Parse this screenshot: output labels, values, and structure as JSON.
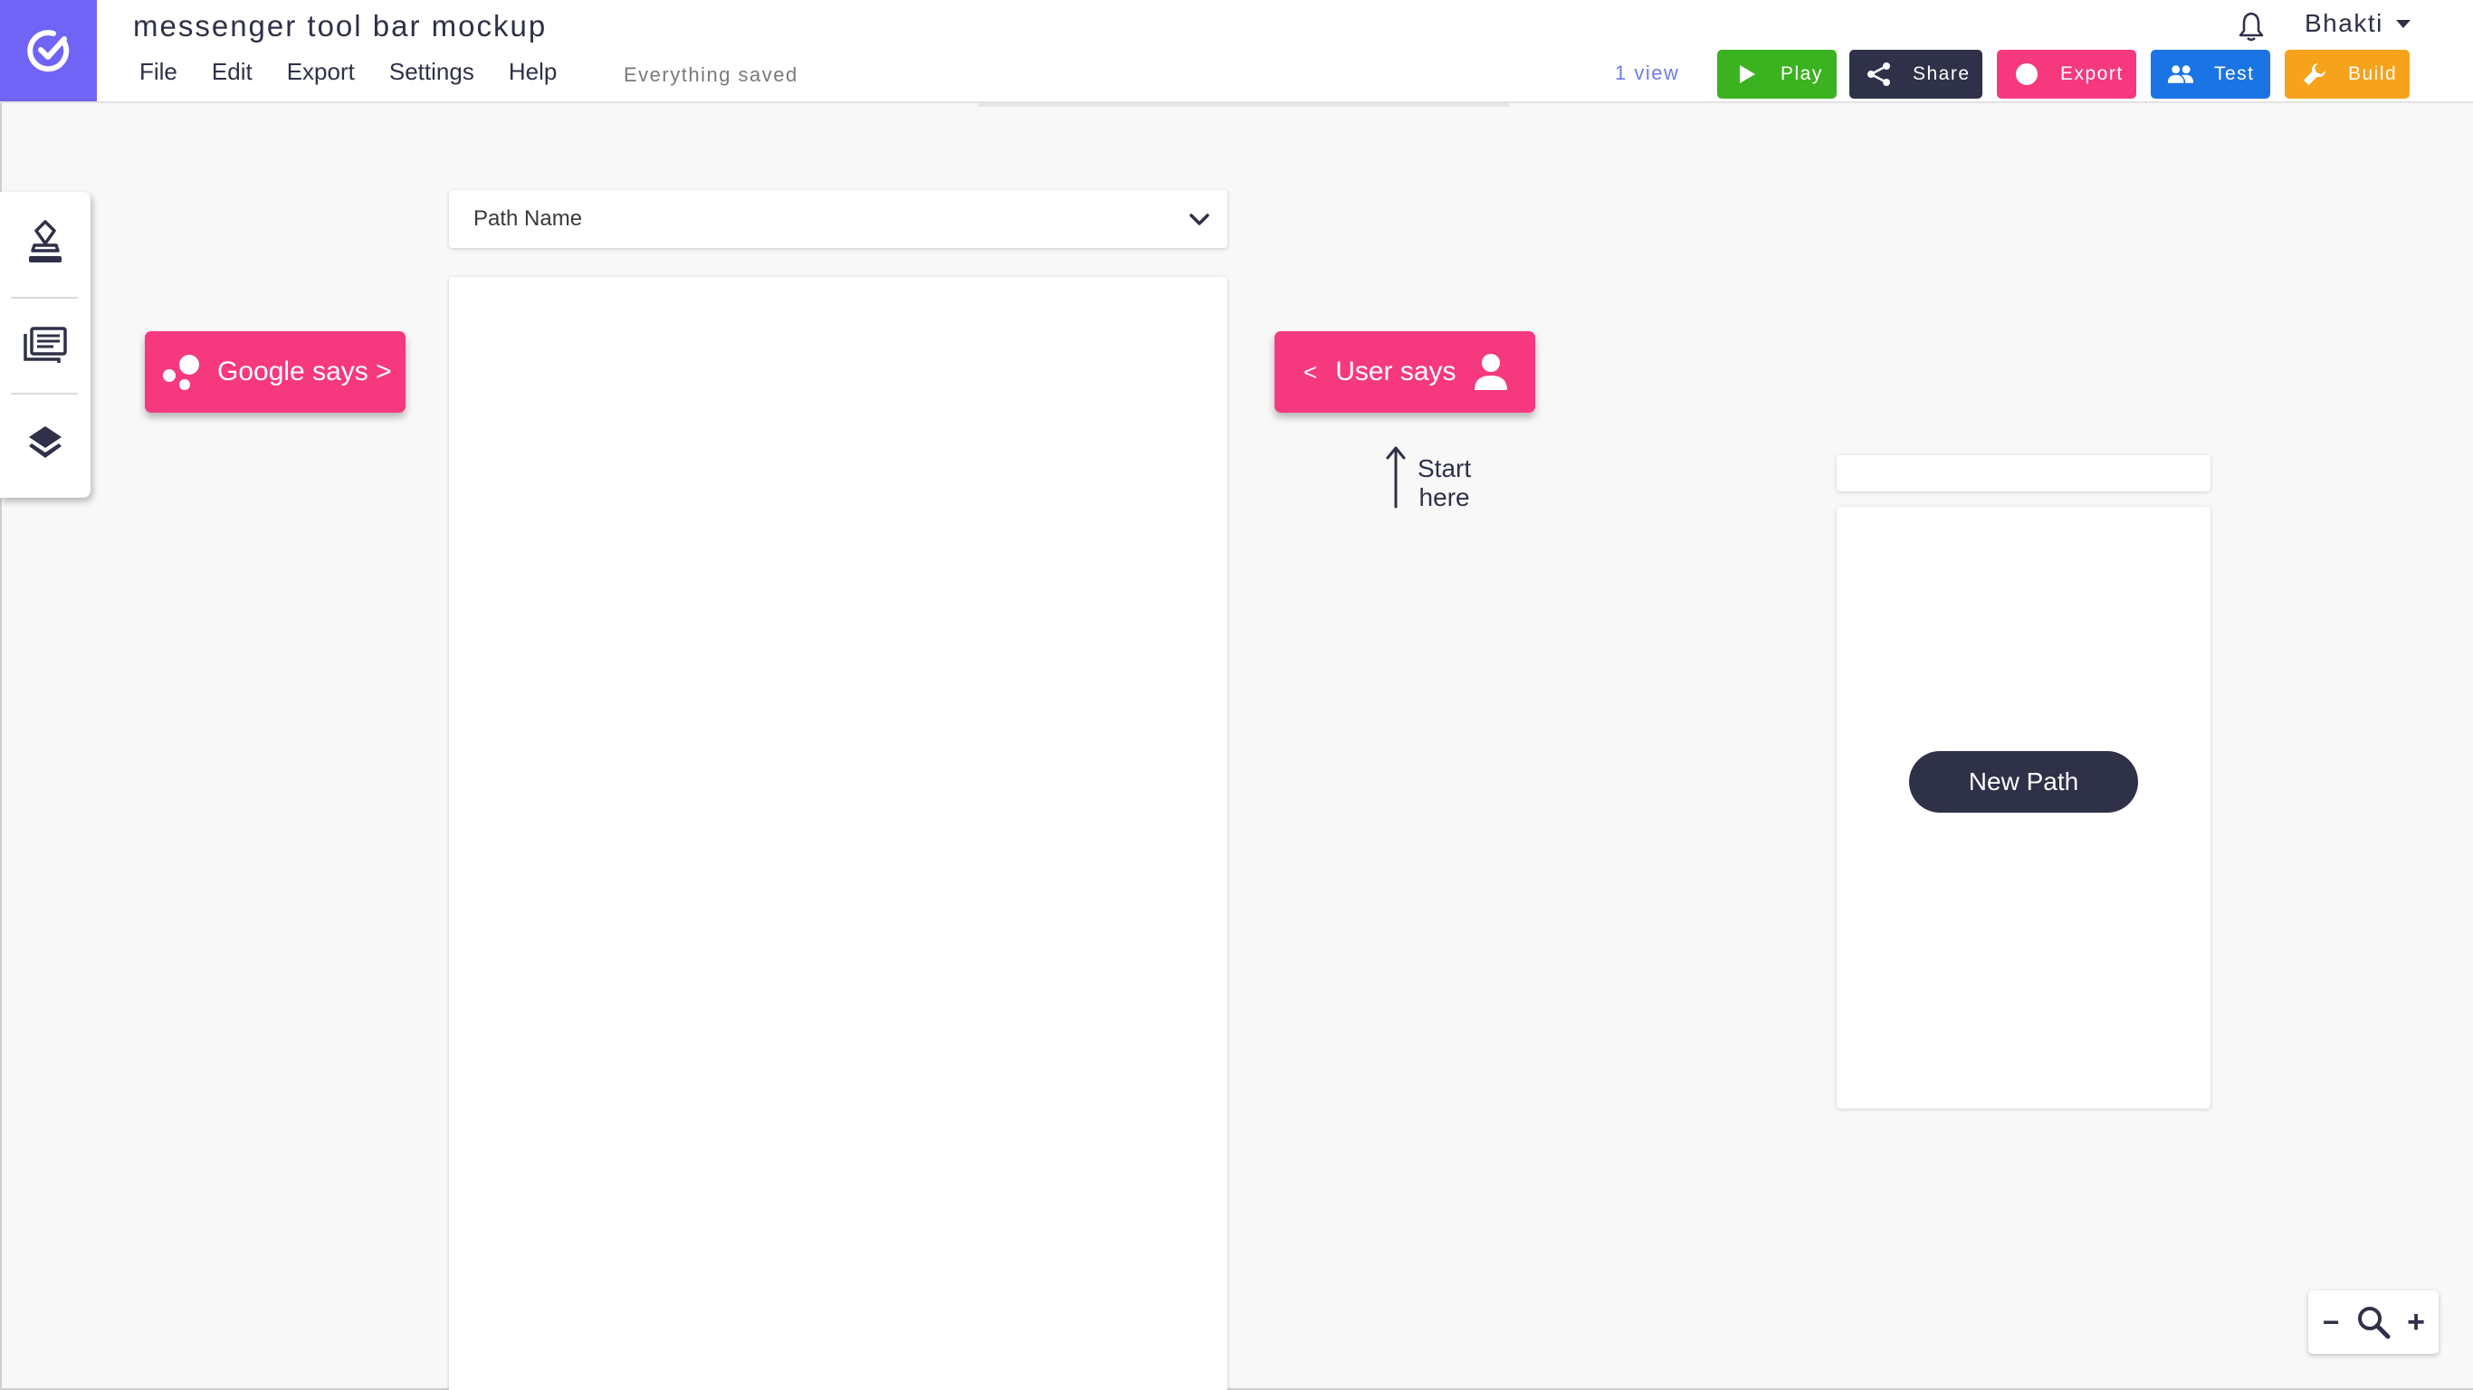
{
  "app": {
    "title": "messenger tool bar mockup",
    "save_status": "Everything saved",
    "views": "1 view",
    "user_name": "Bhakti"
  },
  "menu": [
    "File",
    "Edit",
    "Export",
    "Settings",
    "Help"
  ],
  "toolbar": {
    "play": {
      "label": "Play",
      "color": "#3bb21f",
      "icon": "play-icon"
    },
    "share": {
      "label": "Share",
      "color": "#2e3148",
      "icon": "share-icon"
    },
    "export": {
      "label": "Export",
      "color": "#f6387f",
      "icon": "record-icon"
    },
    "test": {
      "label": "Test",
      "color": "#1b74e4",
      "icon": "users-icon"
    },
    "build": {
      "label": "Build",
      "color": "#f7a21b",
      "icon": "wrench-icon"
    }
  },
  "sidebar": {
    "items": [
      {
        "icon": "eraser-icon"
      },
      {
        "icon": "messages-icon"
      },
      {
        "icon": "layers-icon"
      }
    ]
  },
  "path_panel": {
    "select_value": "Path Name"
  },
  "chips": {
    "google": "Google says >",
    "user_prefix": "<",
    "user": "User says"
  },
  "hint": {
    "line1": "Start",
    "line2": "here"
  },
  "preview": {
    "new_path_label": "New Path"
  },
  "zoom": {
    "minus": "−",
    "plus": "+"
  },
  "colors": {
    "brand": "#6f64f6",
    "accent_pink": "#f6387f",
    "dark": "#2e3148"
  }
}
